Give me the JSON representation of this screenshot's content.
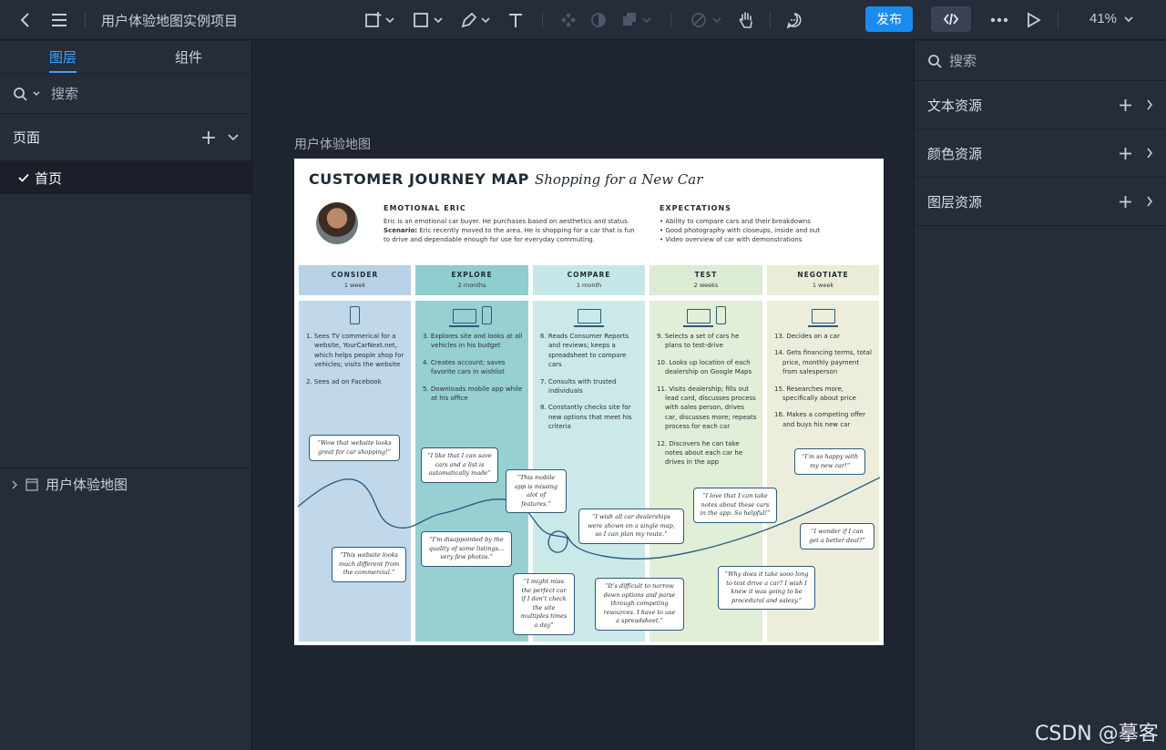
{
  "topbar": {
    "project_title": "用户体验地图实例项目",
    "publish_label": "发布",
    "zoom": "41%"
  },
  "left_panel": {
    "tabs": [
      {
        "label": "图层"
      },
      {
        "label": "组件"
      }
    ],
    "search_placeholder": "搜索",
    "pages_header": "页面",
    "pages": [
      {
        "label": "首页",
        "selected": true
      }
    ],
    "layers": [
      {
        "label": "用户体验地图"
      }
    ]
  },
  "right_panel": {
    "search_placeholder": "搜索",
    "sections": [
      {
        "label": "文本资源"
      },
      {
        "label": "颜色资源"
      },
      {
        "label": "图层资源"
      }
    ]
  },
  "canvas": {
    "artboard_label": "用户体验地图"
  },
  "journey_map": {
    "title": "CUSTOMER JOURNEY MAP",
    "subtitle": "Shopping for a New Car",
    "persona_name": "EMOTIONAL ERIC",
    "persona_desc": "Eric is an emotional car buyer. He purchases based on aesthetics and status.",
    "scenario_label": "Scenario:",
    "scenario_text": "Eric recently moved to the area. He is shopping for a car that is fun to drive and dependable enough for use for everyday commuting.",
    "expectations_title": "EXPECTATIONS",
    "expectations": [
      "• Ability to compare cars and their breakdowns",
      "• Good photography with closeups, inside and out",
      "• Video overview of car with demonstrations"
    ],
    "stages": [
      {
        "name": "CONSIDER",
        "duration": "1 week",
        "head_color": "#b7d1e6",
        "col_color": "#c1d8ea",
        "steps": [
          "1. Sees TV commerical for a website, YourCarNext.net, which helps people shop for vehicles; visits the website",
          "2. Sees ad on Facebook"
        ]
      },
      {
        "name": "EXPLORE",
        "duration": "2 months",
        "head_color": "#8fcdcf",
        "col_color": "#96d0d1",
        "steps": [
          "3. Explores site and looks at all vehicles in his budget",
          "4. Creates account; saves favorite cars in wishlist",
          "5. Downloads mobile app while at his office"
        ]
      },
      {
        "name": "COMPARE",
        "duration": "1 month",
        "head_color": "#c5e7e7",
        "col_color": "#cbe9e9",
        "steps": [
          "6. Reads Consumer Reports and reviews; keeps a spreadsheet to compare cars",
          "7. Consults with trusted individuals",
          "8. Constantly checks site for new options that meet his criteria"
        ]
      },
      {
        "name": "TEST",
        "duration": "2 weeks",
        "head_color": "#dcebd3",
        "col_color": "#e1eed8",
        "steps": [
          "9. Selects a set of cars he plans to test-drive",
          "10. Looks up location of each dealership on Google Maps",
          "11. Visits dealership; fills out lead card, discusses process with sales person, drives car, discusses more; repeats process for each car",
          "12. Discovers he can take notes about each car he drives in the app"
        ]
      },
      {
        "name": "NEGOTIATE",
        "duration": "1 week",
        "head_color": "#e9ecd7",
        "col_color": "#eceedb",
        "steps": [
          "13. Decides on a car",
          "14. Gets financing terms, total price, monthly payment from salesperson",
          "15. Researches more, specifically about price",
          "16. Makes a competing offer and buys his new car"
        ]
      }
    ],
    "quotes": [
      "“Wow that website looks great for car shopping!”",
      "“This website looks much different from the commercial.”",
      "“I like that I can save cars and a list is automatically made”",
      "“I’m disappointed by the quality of some listings... very few photos.”",
      "“This mobile app is missing alot of features.”",
      "“I might miss the perfect car if I don’t check the site multiples times a day”",
      "“I wish all car dealerships were shown on a single map, so I can plan my route.”",
      "“It’s difficult to narrow down options and parse through competing resources. I have to use a spreadsheet.”",
      "“I love that I can take notes about these cars in the app. So helpful!”",
      "“Why does it take sooo long to test drive a car? I wish I knew it was going to be procedural and salesy.”",
      "“I’m so happy with my new car!”",
      "“I wonder if I can get a better deal?”"
    ]
  },
  "watermark": "CSDN @摹客",
  "colors": {
    "accent": "#3ea4ff",
    "publish": "#1a8cf0",
    "curve": "#2c5f86"
  }
}
